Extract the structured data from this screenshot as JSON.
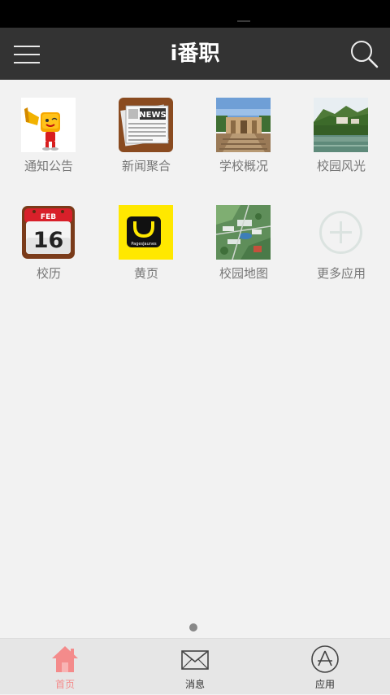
{
  "header": {
    "title": "i番职",
    "menu_icon": "hamburger-menu-icon",
    "search_icon": "search-icon"
  },
  "apps": [
    {
      "label": "通知公告",
      "icon": "megaphone-mascot-icon"
    },
    {
      "label": "新闻聚合",
      "icon": "news-icon",
      "icon_text": "NEWS"
    },
    {
      "label": "学校概况",
      "icon": "school-building-photo-icon"
    },
    {
      "label": "校园风光",
      "icon": "campus-scenery-photo-icon"
    },
    {
      "label": "校历",
      "icon": "calendar-icon",
      "month": "FEB",
      "day": "16"
    },
    {
      "label": "黄页",
      "icon": "yellow-pages-icon",
      "icon_text": "PagesJaunes"
    },
    {
      "label": "校园地图",
      "icon": "campus-map-icon"
    },
    {
      "label": "更多应用",
      "icon": "add-more-icon"
    }
  ],
  "tabbar": {
    "items": [
      {
        "label": "首页",
        "icon": "home-icon",
        "active": true
      },
      {
        "label": "消息",
        "icon": "envelope-icon",
        "active": false
      },
      {
        "label": "应用",
        "icon": "app-store-icon",
        "active": false
      }
    ]
  },
  "colors": {
    "header_bg": "#333333",
    "page_bg": "#f2f2f2",
    "tab_active": "#f48b8b",
    "label_gray": "#777777"
  }
}
